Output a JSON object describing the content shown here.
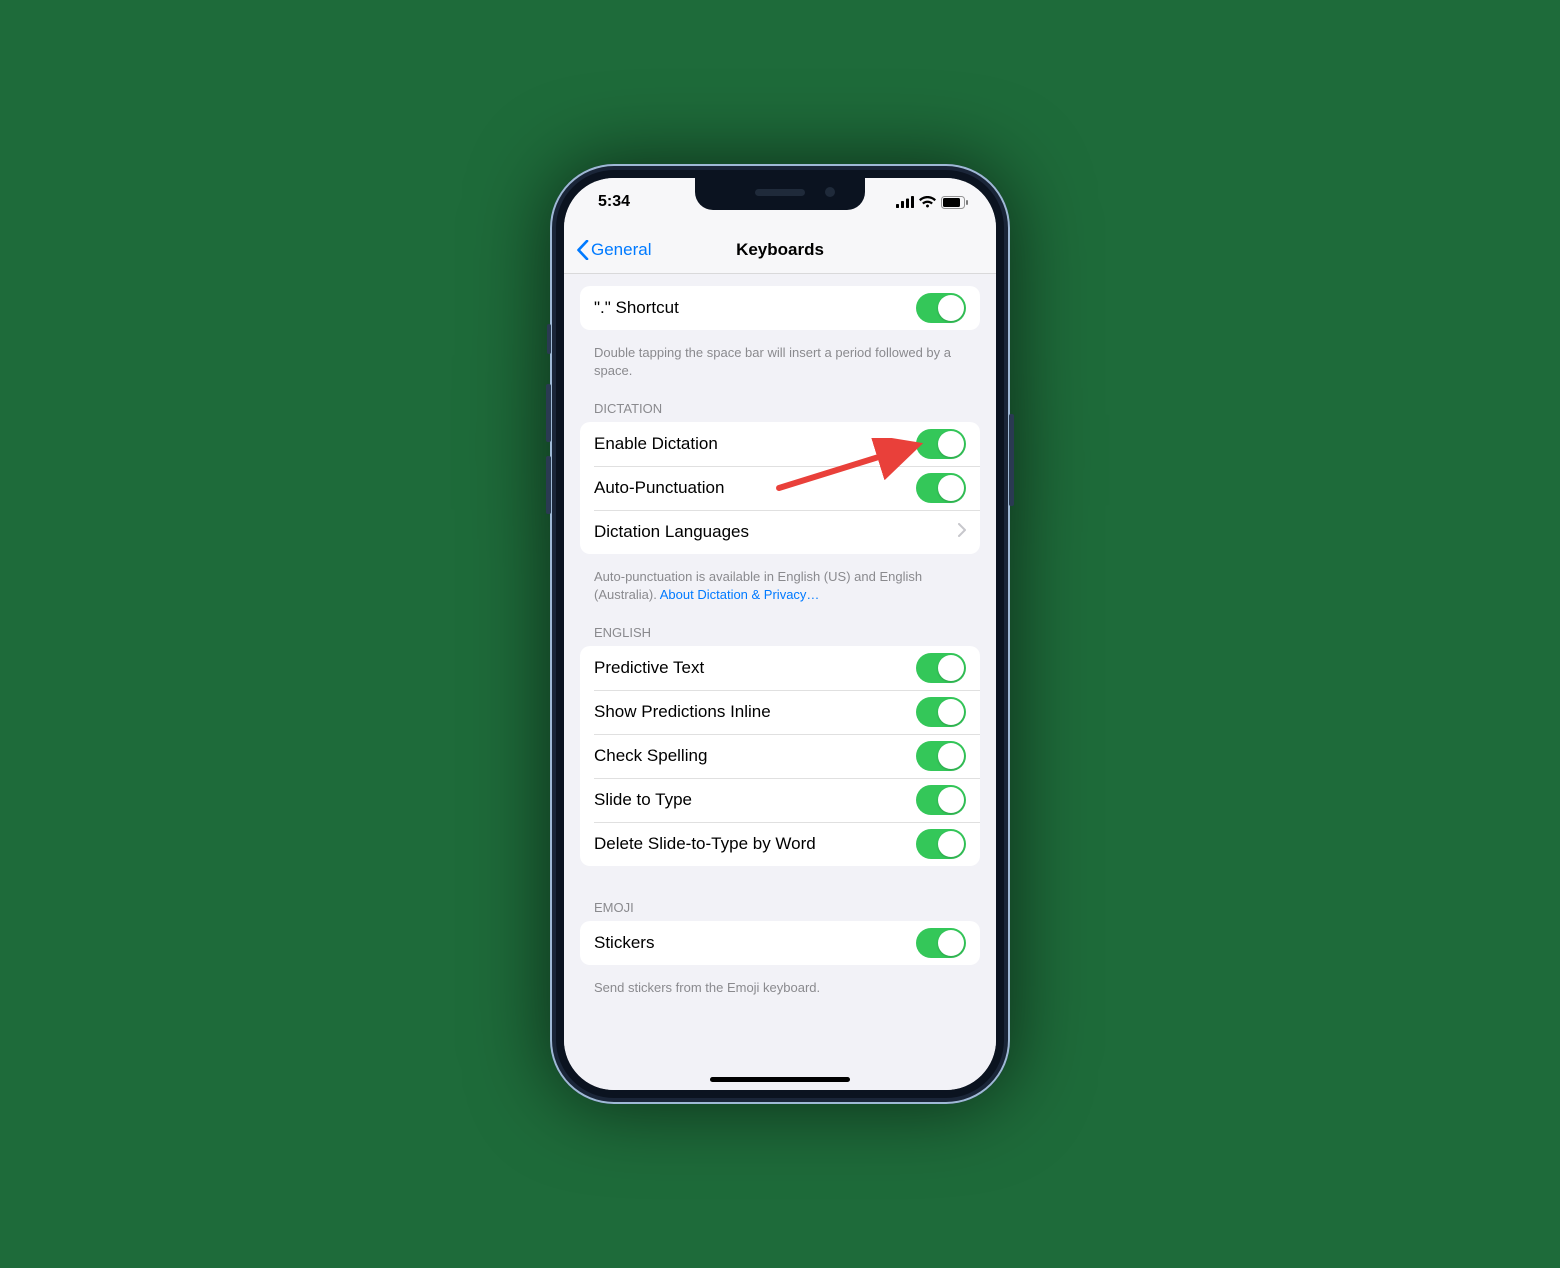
{
  "status": {
    "time": "5:34"
  },
  "nav": {
    "back_label": "General",
    "title": "Keyboards"
  },
  "shortcut": {
    "label": "\".\" Shortcut",
    "footer": "Double tapping the space bar will insert a period followed by a space."
  },
  "dictation": {
    "header": "DICTATION",
    "enable_label": "Enable Dictation",
    "auto_punct_label": "Auto-Punctuation",
    "languages_label": "Dictation Languages",
    "footer_text": "Auto-punctuation is available in English (US) and English (Australia). ",
    "footer_link": "About Dictation & Privacy…"
  },
  "english": {
    "header": "ENGLISH",
    "rows": [
      "Predictive Text",
      "Show Predictions Inline",
      "Check Spelling",
      "Slide to Type",
      "Delete Slide-to-Type by Word"
    ]
  },
  "emoji": {
    "header": "EMOJI",
    "stickers_label": "Stickers",
    "footer": "Send stickers from the Emoji keyboard."
  },
  "colors": {
    "toggle_on": "#34c759",
    "ios_blue": "#007aff",
    "arrow": "#e9403a"
  }
}
